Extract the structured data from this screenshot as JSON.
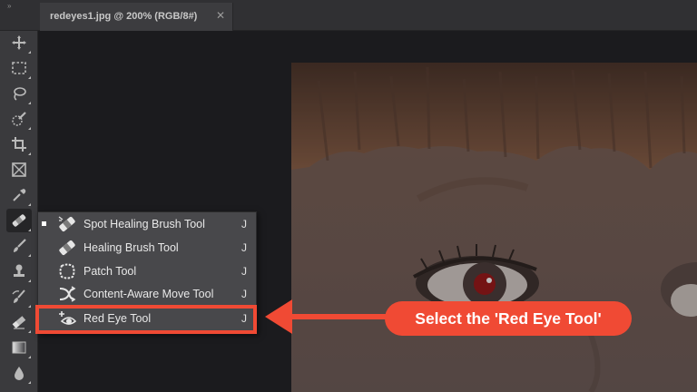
{
  "window": {
    "collapse_glyph": "»",
    "document_tab": {
      "title": "redeyes1.jpg @ 200% (RGB/8#)",
      "close_glyph": "✕"
    }
  },
  "toolbar": {
    "tools": [
      {
        "icon": "move-icon"
      },
      {
        "icon": "marquee-icon"
      },
      {
        "icon": "lasso-icon"
      },
      {
        "icon": "quick-selection-icon"
      },
      {
        "icon": "crop-icon"
      },
      {
        "icon": "frame-icon"
      },
      {
        "icon": "eyedropper-icon"
      },
      {
        "icon": "spot-healing-brush-icon",
        "active": true
      },
      {
        "icon": "brush-icon"
      },
      {
        "icon": "clone-stamp-icon"
      },
      {
        "icon": "history-brush-icon"
      },
      {
        "icon": "eraser-icon"
      },
      {
        "icon": "gradient-icon"
      },
      {
        "icon": "blur-icon"
      }
    ]
  },
  "flyout_menu": {
    "items": [
      {
        "label": "Spot Healing Brush Tool",
        "shortcut": "J",
        "icon": "spot-healing-brush-icon",
        "current": true
      },
      {
        "label": "Healing Brush Tool",
        "shortcut": "J",
        "icon": "healing-brush-icon"
      },
      {
        "label": "Patch Tool",
        "shortcut": "J",
        "icon": "patch-icon"
      },
      {
        "label": "Content-Aware Move Tool",
        "shortcut": "J",
        "icon": "content-aware-move-icon"
      },
      {
        "label": "Red Eye Tool",
        "shortcut": "J",
        "icon": "red-eye-icon",
        "highlighted": true
      }
    ]
  },
  "annotation": {
    "callout_text": "Select the 'Red Eye Tool'",
    "color": "#f04a34"
  },
  "colors": {
    "panel": "#3a3a3d",
    "canvas_bg": "#1b1b1e",
    "menu_bg": "#48484b"
  }
}
